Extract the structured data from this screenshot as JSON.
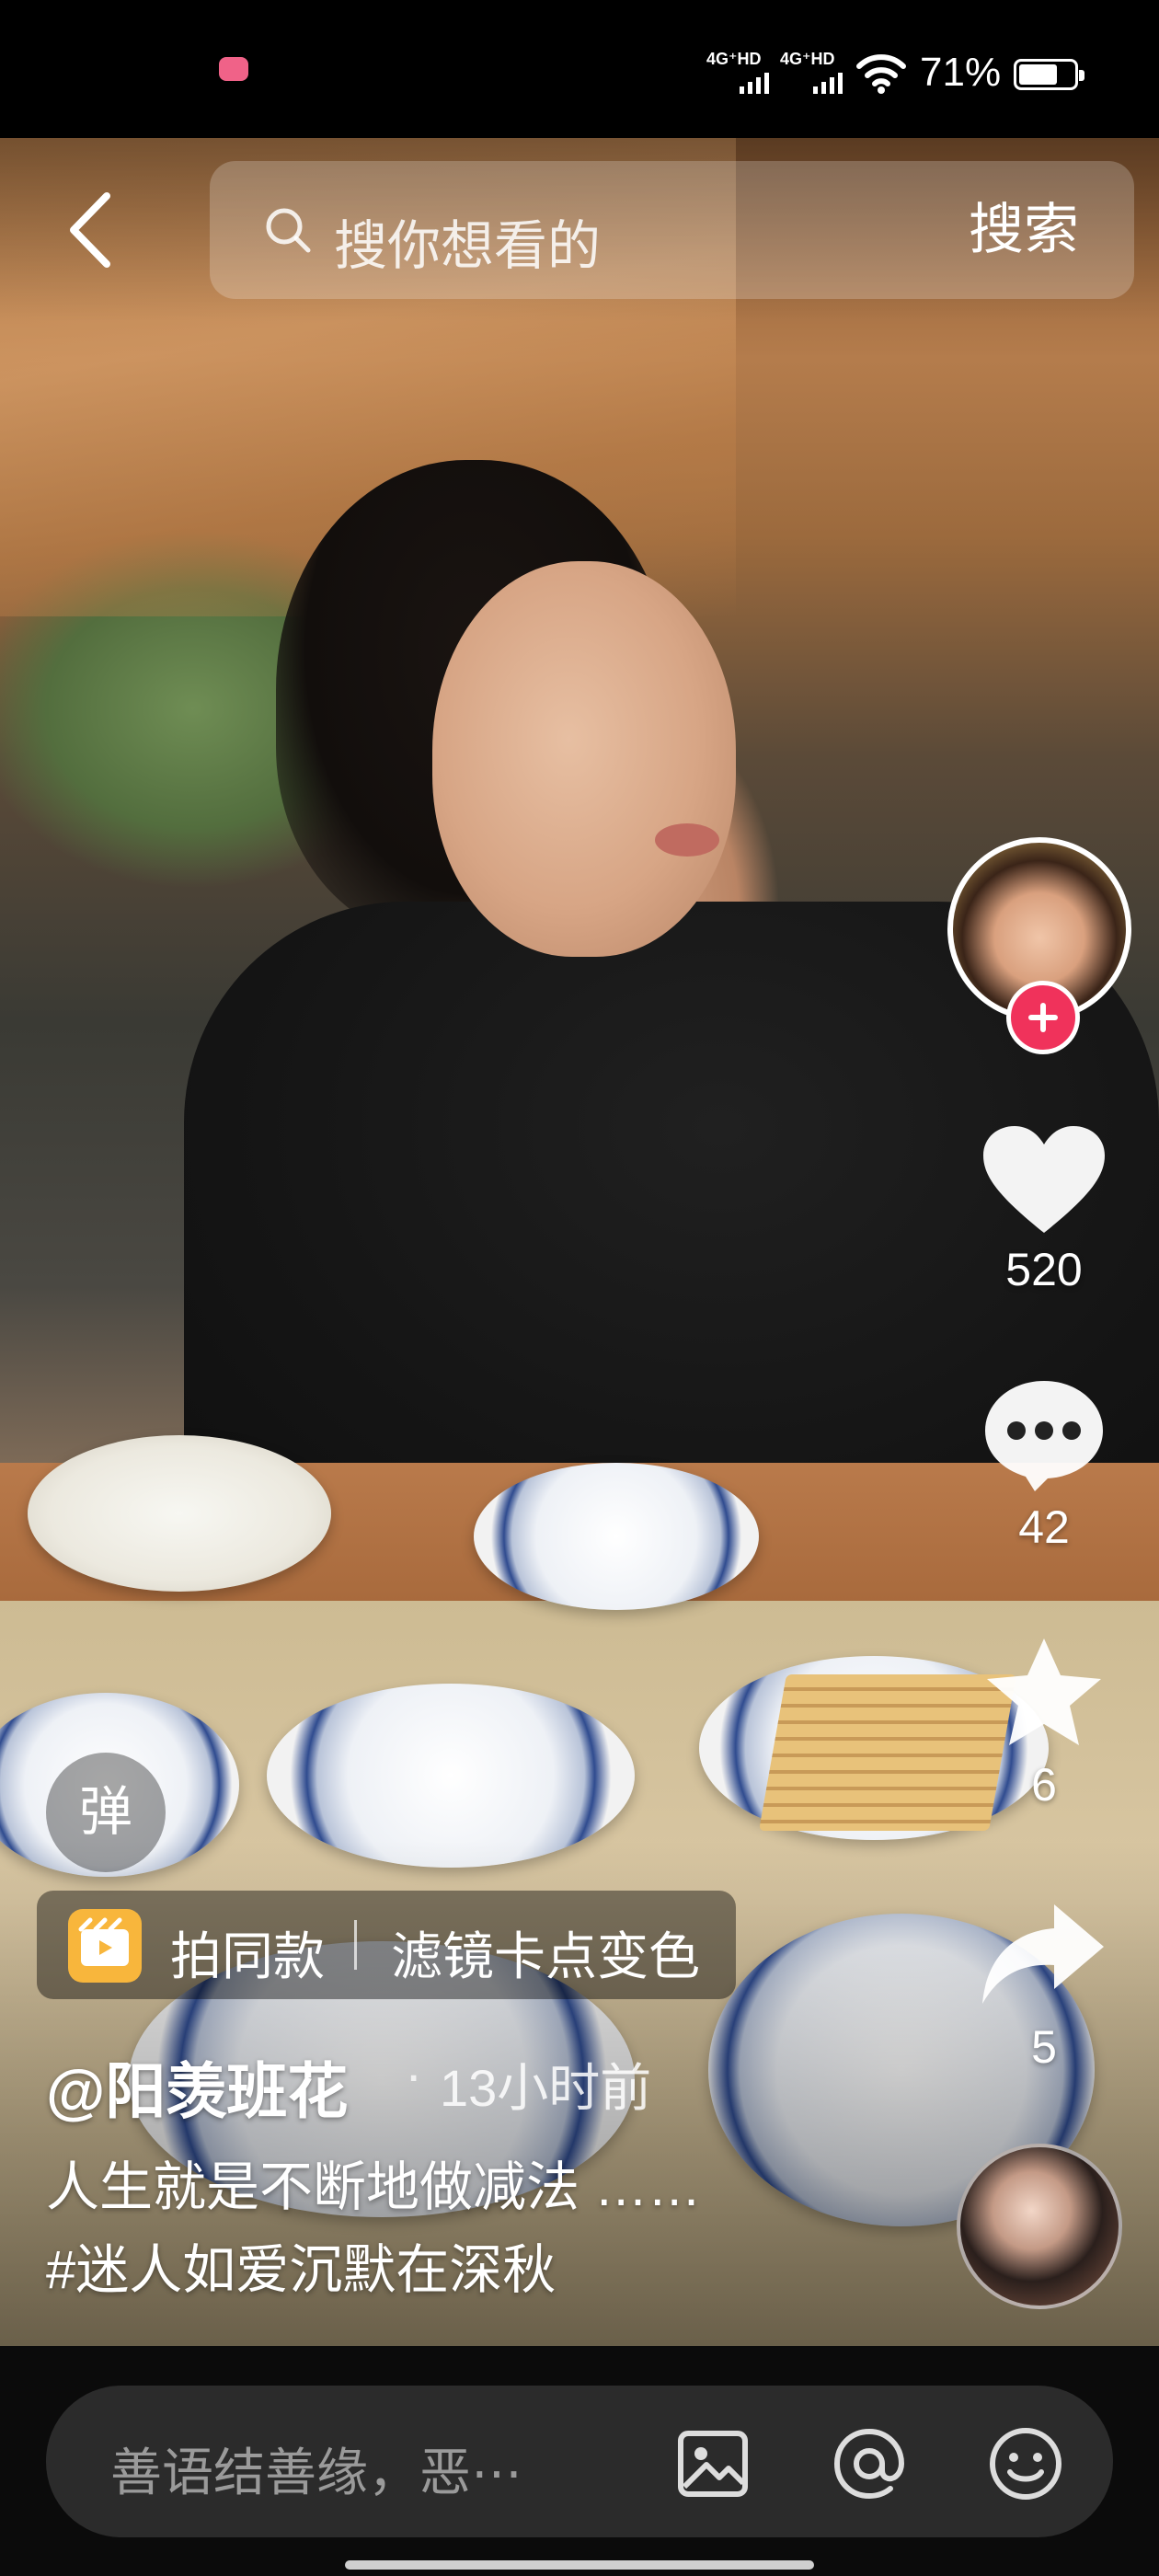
{
  "status_bar": {
    "signal1_label": "4G⁺HD",
    "signal2_label": "4G⁺HD",
    "battery_percent": "71%",
    "battery_level": 0.71,
    "notification_color": "#f06288"
  },
  "search": {
    "placeholder": "搜你想看的",
    "button_label": "搜索"
  },
  "actions": {
    "likes": "520",
    "comments": "42",
    "favorites": "6",
    "shares": "5"
  },
  "danmaku": {
    "label": "弹"
  },
  "template": {
    "label": "拍同款",
    "name": "滤镜卡点变色",
    "icon_color": "#f8b63c"
  },
  "post": {
    "author": "@阳羡班花",
    "separator": "·",
    "time": "13小时前",
    "caption_line1": "人生就是不断地做减法 ……",
    "caption_line2": "#迷人如爱沉默在深秋"
  },
  "comment": {
    "placeholder": "善语结善缘，恶⋯"
  },
  "colors": {
    "accent": "#f0325b",
    "bottom_bar": "#0b0b0b",
    "comment_box": "#2b2b2b"
  }
}
